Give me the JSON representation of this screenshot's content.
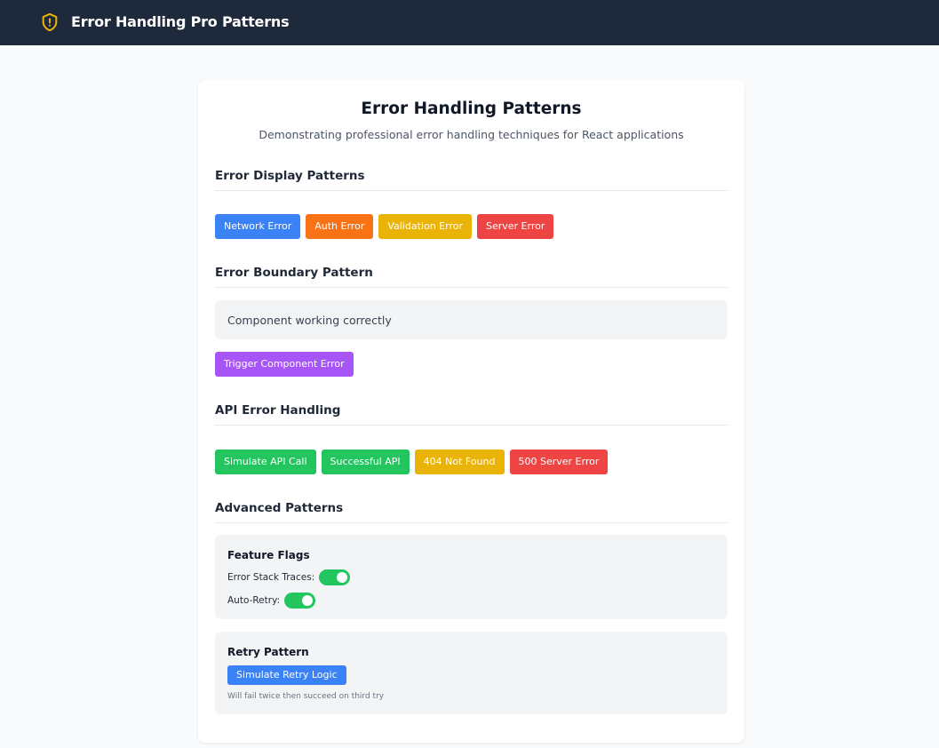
{
  "header": {
    "app_title": "Error Handling Pro Patterns",
    "logo_icon": "shield-alert-icon",
    "logo_color": "#eab308",
    "background": "#1e293b"
  },
  "card": {
    "title": "Error Handling Patterns",
    "subtitle": "Demonstrating professional error handling techniques for React applications"
  },
  "sections": {
    "error_display": {
      "title": "Error Display Patterns",
      "buttons": {
        "network": "Network Error",
        "auth": "Auth Error",
        "validation": "Validation Error",
        "server": "Server Error"
      }
    },
    "error_boundary": {
      "title": "Error Boundary Pattern",
      "status": "Component working correctly",
      "trigger_button": "Trigger Component Error"
    },
    "api_error": {
      "title": "API Error Handling",
      "buttons": {
        "simulate": "Simulate API Call",
        "success": "Successful API",
        "not_found": "404 Not Found",
        "server_error": "500 Server Error"
      }
    },
    "advanced": {
      "title": "Advanced Patterns",
      "feature_flags": {
        "title": "Feature Flags",
        "flags": [
          {
            "label": "Error Stack Traces:",
            "enabled": true
          },
          {
            "label": "Auto-Retry:",
            "enabled": true
          }
        ]
      },
      "retry": {
        "title": "Retry Pattern",
        "button": "Simulate Retry Logic",
        "note": "Will fail twice then succeed on third try"
      }
    }
  },
  "colors": {
    "blue": "#3b82f6",
    "orange": "#f97316",
    "yellow": "#eab308",
    "red": "#ef4444",
    "purple": "#a855f7",
    "green": "#22c55e"
  }
}
